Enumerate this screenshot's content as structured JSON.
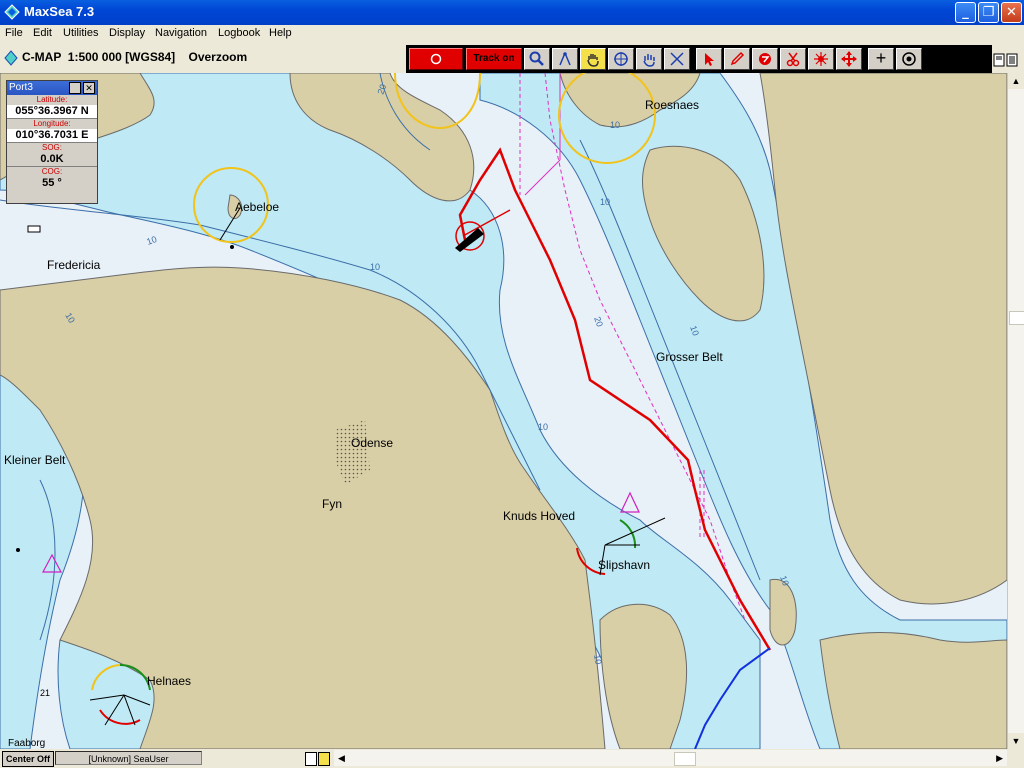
{
  "window": {
    "title": "MaxSea 7.3"
  },
  "menu": [
    "File",
    "Edit",
    "Utilities",
    "Display",
    "Navigation",
    "Logbook",
    "Help"
  ],
  "chart_bar": {
    "label": "C-MAP  1:500 000 [WGS84]    Overzoom"
  },
  "toolbar": {
    "track_label": "Track on"
  },
  "panel": {
    "title": "Port3",
    "latitude_label": "Latitude:",
    "latitude": "055°36.3967 N",
    "longitude_label": "Longitude:",
    "longitude": "010°36.7031 E",
    "sog_label": "SOG:",
    "sog": "0.0K",
    "cog_label": "COG:",
    "cog": "55 °"
  },
  "map_labels": {
    "roesnaes": "Roesnaes",
    "aebeloe": "Aebeloe",
    "fredericia": "Fredericia",
    "grosser_belt": "Grosser Belt",
    "odense": "Odense",
    "kleiner_belt": "Kleiner Belt",
    "fyn": "Fyn",
    "knuds_hoved": "Knuds Hoved",
    "slipshavn": "Slipshavn",
    "helnaes": "Helnaes",
    "faaborg": "Faaborg",
    "depth_21": "21"
  },
  "depth_labels": [
    "10",
    "20"
  ],
  "status": {
    "center_off": "Center Off",
    "user": "[Unknown] SeaUser"
  },
  "colors": {
    "land": "#d9cfa6",
    "shallow": "#bfe9f4",
    "deep": "#e8f0f8",
    "track": "#e00000",
    "route": "#e030c0",
    "light_ring": "#f2c318"
  }
}
